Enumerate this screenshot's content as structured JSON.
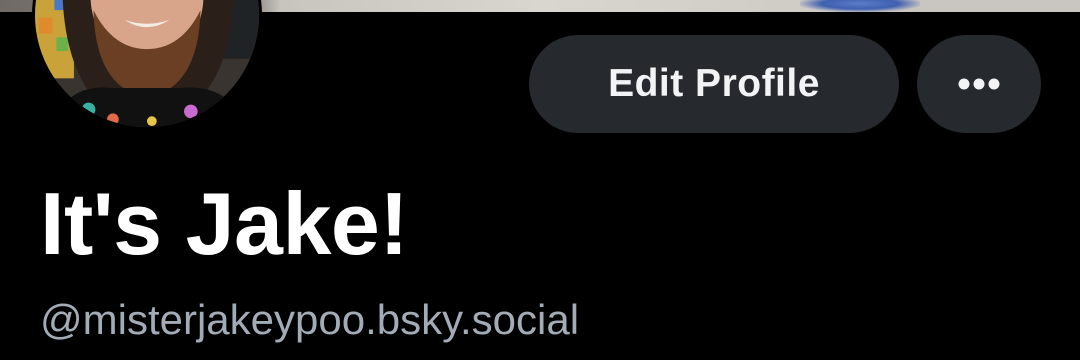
{
  "profile": {
    "display_name": "It's Jake!",
    "handle": "@misterjakeypoo.bsky.social",
    "avatar_alt": "profile avatar"
  },
  "actions": {
    "edit_profile_label": "Edit Profile",
    "more_icon": "ellipsis-horizontal-icon"
  },
  "theme": {
    "background": "#000000",
    "button_background": "#26292d",
    "button_text": "#f1f3f5",
    "name_color": "#ffffff",
    "handle_color": "#a3abb6"
  }
}
